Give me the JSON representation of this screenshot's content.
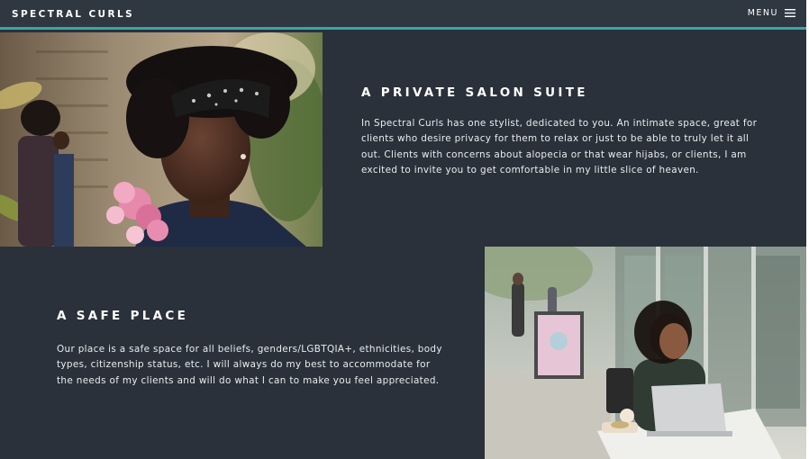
{
  "header": {
    "brand": "SPECTRAL CURLS",
    "menu_label": "MENU",
    "menu_icon": "hamburger-icon",
    "accent_color": "#3aa6a6",
    "background_color": "#2f3741"
  },
  "page": {
    "background_color": "#2a313a"
  },
  "sections": [
    {
      "heading": "A PRIVATE SALON SUITE",
      "body": "In Spectral Curls has one stylist, dedicated to you. An intimate space, great for clients who desire privacy for them to relax or just to be able to truly let it all out. Clients with concerns about alopecia or that wear hijabs, or clients, I am excited to invite you to get comfortable in my little slice of heaven.",
      "image": "woman-with-bandana-and-pink-flowers-photo"
    },
    {
      "heading": "A SAFE PLACE",
      "body": "Our place is a safe space for all beliefs, genders/LGBTQIA+, ethnicities, body types, citizenship status, etc. I will always do my best to accommodate for the needs of my clients and will do what I can to make you feel appreciated.",
      "image": "woman-with-laptop-at-cafe-photo"
    }
  ]
}
